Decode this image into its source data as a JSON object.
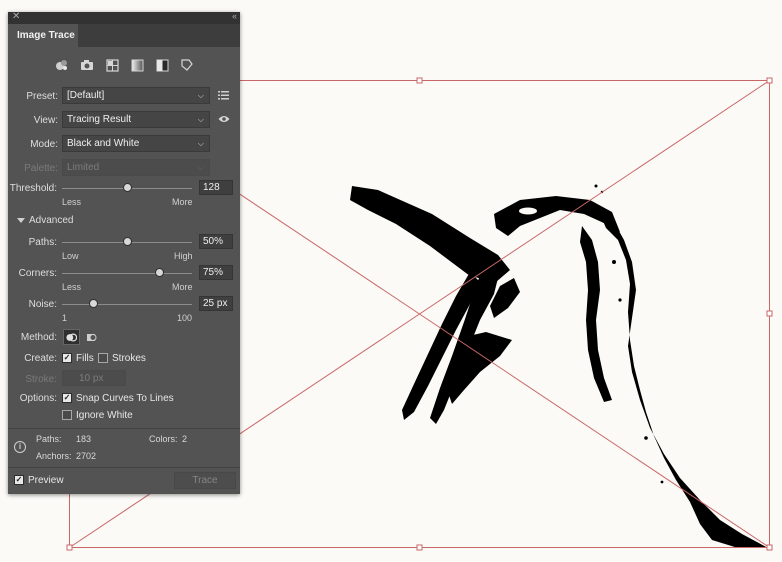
{
  "panel": {
    "tab_title": "Image Trace",
    "close_icon": "close-icon",
    "collapse_icon": "collapse-panel-icon",
    "presets": [
      "auto-color-icon",
      "high-color-icon",
      "low-color-icon",
      "grayscale-icon",
      "black-and-white-icon",
      "outline-icon"
    ],
    "preset_label": "Preset:",
    "preset_value": "[Default]",
    "view_label": "View:",
    "view_value": "Tracing Result",
    "mode_label": "Mode:",
    "mode_value": "Black and White",
    "palette_label": "Palette:",
    "palette_value": "Limited",
    "threshold": {
      "label": "Threshold:",
      "value": "128",
      "min_label": "Less",
      "max_label": "More",
      "level": 0.5
    },
    "advanced_label": "Advanced",
    "paths": {
      "label": "Paths:",
      "value": "50%",
      "min_label": "Low",
      "max_label": "High",
      "level": 0.5
    },
    "corners": {
      "label": "Corners:",
      "value": "75%",
      "min_label": "Less",
      "max_label": "More",
      "level": 0.75
    },
    "noise": {
      "label": "Noise:",
      "value": "25 px",
      "min_label": "1",
      "max_label": "100",
      "level": 0.24
    },
    "method_label": "Method:",
    "create_label": "Create:",
    "fills_label": "Fills",
    "fills_checked": true,
    "strokes_label": "Strokes",
    "strokes_checked": false,
    "stroke_label": "Stroke:",
    "stroke_value": "10 px",
    "options_label": "Options:",
    "snap_label": "Snap Curves To Lines",
    "snap_checked": true,
    "ignore_white_label": "Ignore White",
    "ignore_white_checked": false,
    "stats": {
      "paths_label": "Paths:",
      "paths_value": "183",
      "colors_label": "Colors:",
      "colors_value": "2",
      "anchors_label": "Anchors:",
      "anchors_value": "2702"
    },
    "preview_label": "Preview",
    "preview_checked": true,
    "trace_label": "Trace"
  },
  "canvas": {
    "selection_color": "#c96767",
    "artwork_color": "#000000"
  }
}
